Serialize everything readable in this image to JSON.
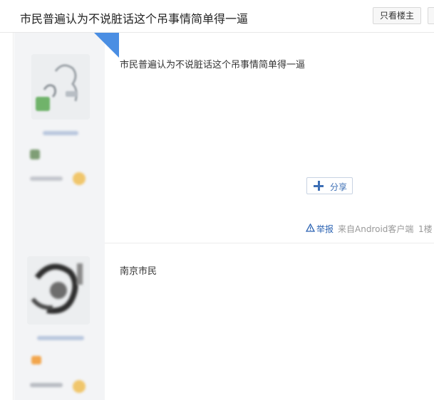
{
  "header": {
    "title": "市民普遍认为不说脏话这个吊事情简单得一逼",
    "only_op_label": "只看楼主"
  },
  "posts": [
    {
      "content": "市民普遍认为不说脏话这个吊事情简单得一逼",
      "share_label": "分享",
      "footer": {
        "report_label": "举报",
        "client_text": "来自Android客户端",
        "floor_text": "1楼"
      }
    },
    {
      "content": "南京市民"
    }
  ],
  "icons": {
    "share": "plus-icon",
    "report": "warning-triangle-icon"
  },
  "colors": {
    "link": "#2d64b3",
    "badge": "#4a8ee3",
    "sidebar_bg": "#f3f4f6"
  }
}
